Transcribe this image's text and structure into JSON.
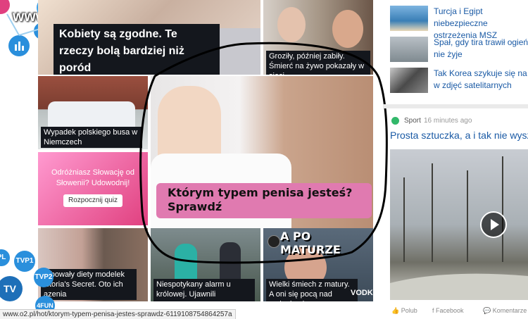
{
  "watermark": "www.wiocha.pl",
  "tiles": {
    "top_left": {
      "caption": "Kobiety są zgodne. Te rzeczy bolą bardziej niż poród"
    },
    "top_right": {
      "caption": "Groziły, później zabiły. Śmierć na żywo pokazały w sieci"
    },
    "bus": {
      "caption": "Wypadek polskiego busa w Niemczech"
    },
    "quiz": {
      "title": "Odróżniasz Słowację od Słowenii? Udowodnij!",
      "button": "Rozpocznij quiz"
    },
    "center": {
      "caption": "Którym typem penisa jesteś? Sprawdź"
    },
    "models": {
      "caption": "robowały diety modelek ictoria's Secret. Oto ich azenia"
    },
    "queen": {
      "caption": "Niespotykany alarm u królowej. Ujawnili przyczynę"
    },
    "matura": {
      "overlay": "A PO MATURZE",
      "caption": "Wielki śmiech z matury. A oni się pocą nad zadaniami",
      "brand": "VODKI"
    }
  },
  "news": [
    {
      "text": "Turcja i Egipt niebezpieczne ostrzeżenia MSZ"
    },
    {
      "text": "Spał, gdy tira trawił ogień. nie żyje"
    },
    {
      "text": "Tak Korea szykuje się na w zdjęć satelitarnych"
    }
  ],
  "video": {
    "category": "Sport",
    "time": "16 minutes ago",
    "title": "Prosta sztuczka, a i tak nie wyszła"
  },
  "social": {
    "like": "Polub",
    "facebook": "Facebook",
    "comments": "Komentarze"
  },
  "tv": {
    "pl": "PL",
    "tvp1": "TVP1",
    "tvp2": "TVP2",
    "tv": "TV",
    "fun": "4FUN"
  },
  "status_url": "www.o2.pl/hot/ktorym-typem-penisa-jestes-sprawdz-6119108754864257a",
  "colors": {
    "link": "#1a5aa5",
    "caption_bg": "#14171d",
    "quiz_bg": "#e0407f",
    "center_caption_bg": "#e07ab0"
  }
}
